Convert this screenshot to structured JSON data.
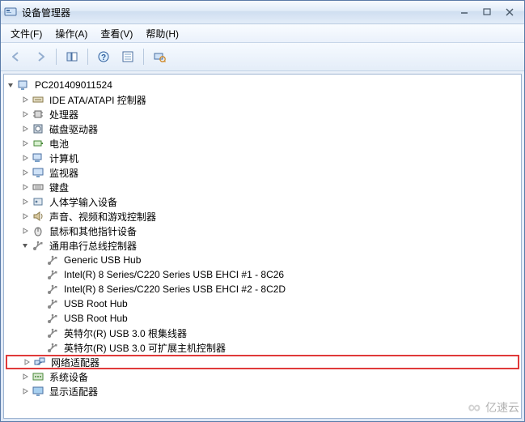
{
  "window": {
    "title": "设备管理器",
    "menus": {
      "file": "文件(F)",
      "action": "操作(A)",
      "view": "查看(V)",
      "help": "帮助(H)"
    }
  },
  "tree": {
    "root": "PC201409011524",
    "items": [
      {
        "label": "IDE ATA/ATAPI 控制器",
        "icon": "ide"
      },
      {
        "label": "处理器",
        "icon": "cpu"
      },
      {
        "label": "磁盘驱动器",
        "icon": "disk"
      },
      {
        "label": "电池",
        "icon": "battery"
      },
      {
        "label": "计算机",
        "icon": "computer"
      },
      {
        "label": "监视器",
        "icon": "monitor"
      },
      {
        "label": "键盘",
        "icon": "keyboard"
      },
      {
        "label": "人体学输入设备",
        "icon": "hid"
      },
      {
        "label": "声音、视频和游戏控制器",
        "icon": "sound"
      },
      {
        "label": "鼠标和其他指针设备",
        "icon": "mouse"
      },
      {
        "label": "通用串行总线控制器",
        "icon": "usb-ctrl",
        "expanded": true,
        "children": [
          {
            "label": "Generic USB Hub",
            "icon": "usb"
          },
          {
            "label": "Intel(R) 8 Series/C220 Series USB EHCI #1 - 8C26",
            "icon": "usb"
          },
          {
            "label": "Intel(R) 8 Series/C220 Series USB EHCI #2 - 8C2D",
            "icon": "usb"
          },
          {
            "label": "USB Root Hub",
            "icon": "usb"
          },
          {
            "label": "USB Root Hub",
            "icon": "usb"
          },
          {
            "label": "英特尔(R) USB 3.0 根集线器",
            "icon": "usb"
          },
          {
            "label": "英特尔(R) USB 3.0 可扩展主机控制器",
            "icon": "usb"
          }
        ]
      },
      {
        "label": "网络适配器",
        "icon": "network",
        "highlight": true
      },
      {
        "label": "系统设备",
        "icon": "system"
      },
      {
        "label": "显示适配器",
        "icon": "display"
      }
    ]
  },
  "watermark": {
    "text": "亿速云"
  }
}
